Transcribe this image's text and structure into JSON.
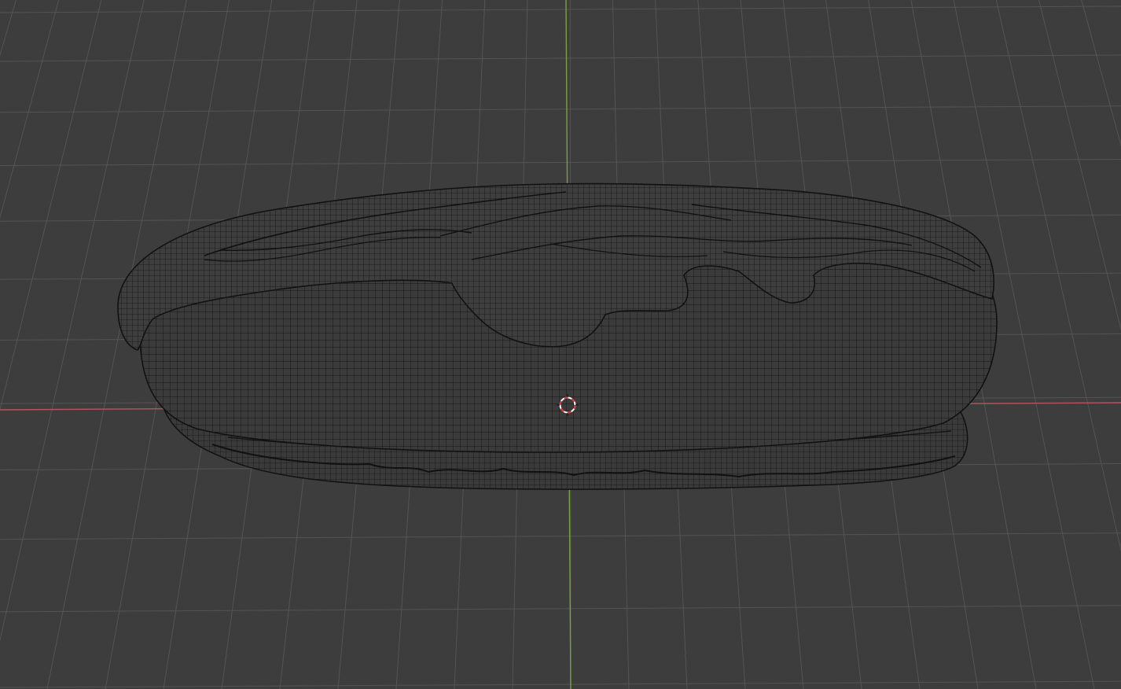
{
  "viewport": {
    "view_mode": "perspective",
    "shading": "wireframe",
    "background_color": "#3d3d3d",
    "grid_color": "#545454",
    "x_axis_color": "#b8545f",
    "y_axis_color": "#79a23d",
    "mesh_fill_color": "#3c3c3c",
    "mesh_wire_color": "#141414",
    "cursor_ring_color": "#ffffff",
    "cursor_dash_color": "#d8343c"
  },
  "scene": {
    "object": {
      "kind": "mesh",
      "shape": "bread-roll-with-glaze",
      "parts": [
        "bottom-bun",
        "filling-layer",
        "top-bun",
        "glaze-drips"
      ]
    },
    "icons": [
      "3d-cursor-icon"
    ]
  }
}
